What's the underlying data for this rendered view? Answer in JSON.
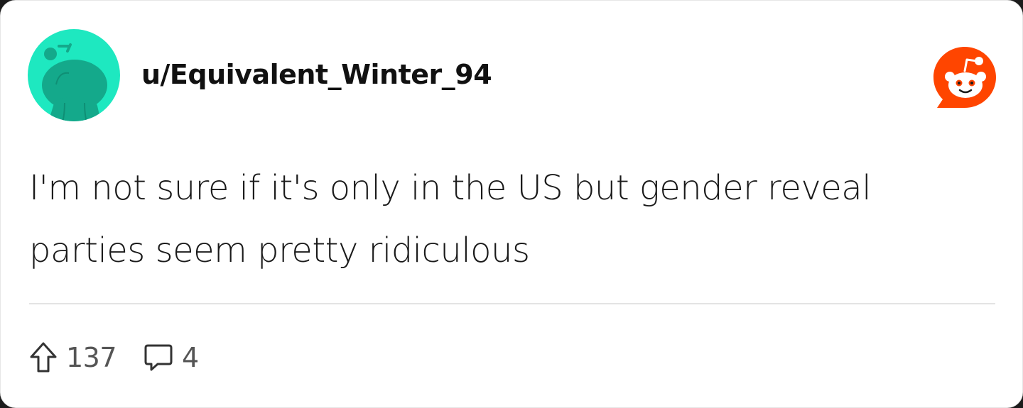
{
  "post": {
    "username": "u/Equivalent_Winter_94",
    "text": "I'm not sure if it's only in the US but gender reveal parties seem pretty ridiculous",
    "upvotes": "137",
    "comments": "4"
  },
  "icons": {
    "avatar": "snoo-avatar-icon",
    "brand": "reddit-logo-icon",
    "upvote": "upvote-arrow-icon",
    "comment": "comment-bubble-icon"
  },
  "colors": {
    "avatar_bg": "#1ee8c0",
    "avatar_figure": "#14a98b",
    "reddit_orange": "#ff4500",
    "text": "#1a1a1a",
    "muted": "#555555"
  }
}
